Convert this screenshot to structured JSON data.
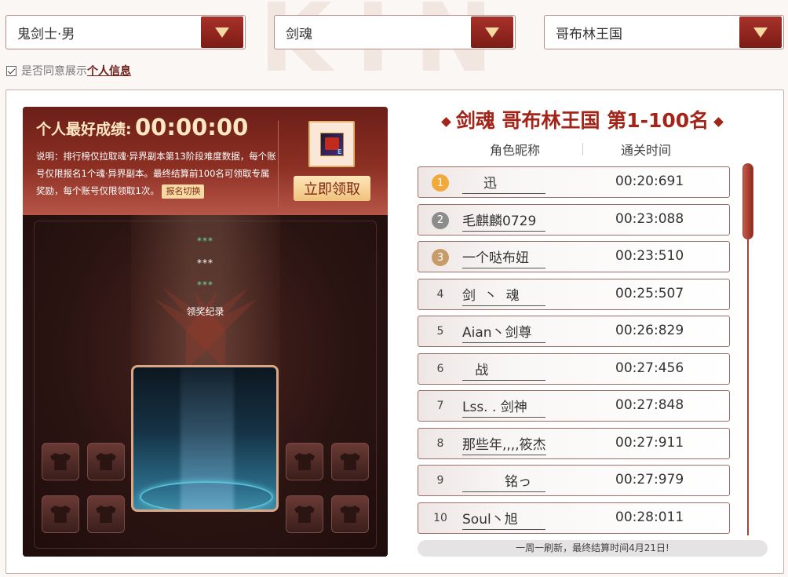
{
  "filters": {
    "character": "鬼剑士·男",
    "job": "剑魂",
    "server": "哥布林王国"
  },
  "consent": {
    "text": "是否同意展示",
    "link": "个人信息",
    "checked": true
  },
  "personal": {
    "best_label": "个人最好成绩:",
    "best_time": "00:00:00",
    "description": "说明：排行榜仅拉取魂·异界副本第13阶段难度数据，每个账号仅限报名1个魂·异界副本。最终结算前100名可领取专属奖励，每个账号仅限领取1次。",
    "switch_label": "报名切换",
    "claim_label": "立即领取"
  },
  "award_log": {
    "stars": [
      "***",
      "***",
      "***"
    ],
    "label": "领奖纪录"
  },
  "ranking": {
    "title": "剑魂 哥布林王国 第1-100名",
    "col_name": "角色昵称",
    "col_time": "通关时间",
    "rows": [
      {
        "rank": "1",
        "name": "     迅     ",
        "time": "00:20:691",
        "badge": "gold"
      },
      {
        "rank": "2",
        "name": "毛麒麟0729",
        "time": "00:23:088",
        "badge": "silver"
      },
      {
        "rank": "3",
        "name": "一个哒布妞",
        "time": "00:23:510",
        "badge": "bronze"
      },
      {
        "rank": "4",
        "name": "剑  丶  魂",
        "time": "00:25:507",
        "badge": ""
      },
      {
        "rank": "5",
        "name": "Aian丶剑尊",
        "time": "00:26:829",
        "badge": ""
      },
      {
        "rank": "6",
        "name": "   战    ",
        "time": "00:27:456",
        "badge": ""
      },
      {
        "rank": "7",
        "name": "Lss. . 剑神",
        "time": "00:27:848",
        "badge": ""
      },
      {
        "rank": "8",
        "name": "那些年,,,,筱杰",
        "time": "00:27:911",
        "badge": ""
      },
      {
        "rank": "9",
        "name": "          铭っ",
        "time": "00:27:979",
        "badge": ""
      },
      {
        "rank": "10",
        "name": "Soul丶旭",
        "time": "00:28:011",
        "badge": ""
      }
    ],
    "footer": "一周一刷新，最终结算时间4月21日!"
  },
  "colors": {
    "accent": "#a3251a",
    "gold": "#f0a93a",
    "silver": "#8c8c8c",
    "bronze": "#c89c6a"
  }
}
